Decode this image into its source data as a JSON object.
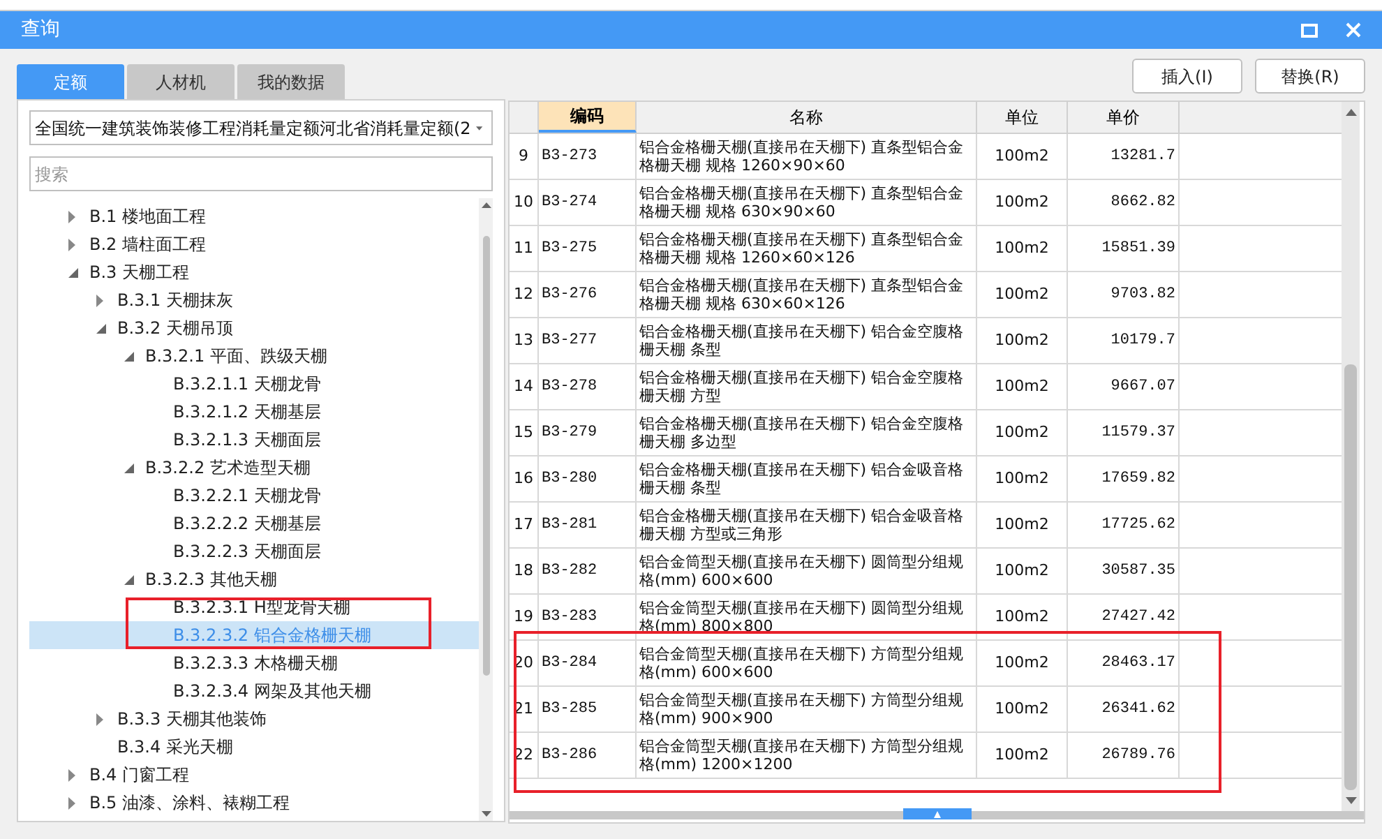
{
  "window": {
    "title": "查询"
  },
  "tabs": [
    {
      "label": "定额",
      "selected": true
    },
    {
      "label": "人材机",
      "selected": false
    },
    {
      "label": "我的数据",
      "selected": false
    }
  ],
  "buttons": [
    "插入(I)",
    "替换(R)"
  ],
  "library_select": {
    "value": "全国统一建筑装饰装修工程消耗量定额河北省消耗量定额(2"
  },
  "search": {
    "placeholder": "搜索"
  },
  "tree": [
    {
      "label": "B.1 楼地面工程",
      "kind": "group",
      "expanded": false,
      "selected": false
    },
    {
      "label": "B.2 墙柱面工程",
      "kind": "group",
      "expanded": false,
      "selected": false
    },
    {
      "label": "B.3 天棚工程",
      "kind": "group",
      "expanded": true,
      "selected": false,
      "children": [
        {
          "label": "B.3.1 天棚抹灰",
          "kind": "group",
          "expanded": false,
          "selected": false
        },
        {
          "label": "B.3.2 天棚吊顶",
          "kind": "group",
          "expanded": true,
          "selected": false,
          "children": [
            {
              "label": "B.3.2.1 平面、跌级天棚",
              "kind": "group",
              "expanded": true,
              "selected": false,
              "children": [
                {
                  "label": "B.3.2.1.1 天棚龙骨",
                  "kind": "leaf",
                  "selected": false
                },
                {
                  "label": "B.3.2.1.2 天棚基层",
                  "kind": "leaf",
                  "selected": false
                },
                {
                  "label": "B.3.2.1.3 天棚面层",
                  "kind": "leaf",
                  "selected": false
                }
              ]
            },
            {
              "label": "B.3.2.2 艺术造型天棚",
              "kind": "group",
              "expanded": true,
              "selected": false,
              "children": [
                {
                  "label": "B.3.2.2.1 天棚龙骨",
                  "kind": "leaf",
                  "selected": false
                },
                {
                  "label": "B.3.2.2.2 天棚基层",
                  "kind": "leaf",
                  "selected": false
                },
                {
                  "label": "B.3.2.2.3 天棚面层",
                  "kind": "leaf",
                  "selected": false
                }
              ]
            },
            {
              "label": "B.3.2.3 其他天棚",
              "kind": "group",
              "expanded": true,
              "selected": false,
              "children": [
                {
                  "label": "B.3.2.3.1 H型龙骨天棚",
                  "kind": "leaf",
                  "selected": false
                },
                {
                  "label": "B.3.2.3.2 铝合金格栅天棚",
                  "kind": "leaf",
                  "selected": true
                },
                {
                  "label": "B.3.2.3.3 木格栅天棚",
                  "kind": "leaf",
                  "selected": false
                },
                {
                  "label": "B.3.2.3.4 网架及其他天棚",
                  "kind": "leaf",
                  "selected": false
                }
              ]
            }
          ]
        },
        {
          "label": "B.3.3 天棚其他装饰",
          "kind": "group",
          "expanded": false,
          "selected": false
        },
        {
          "label": "B.3.4 采光天棚",
          "kind": "leaf",
          "selected": false
        }
      ]
    },
    {
      "label": "B.4 门窗工程",
      "kind": "group",
      "expanded": false,
      "selected": false
    },
    {
      "label": "B.5 油漆、涂料、裱糊工程",
      "kind": "group",
      "expanded": false,
      "selected": false
    }
  ],
  "table": {
    "columns": [
      {
        "label": "编码",
        "selected": true
      },
      {
        "label": "名称",
        "selected": false
      },
      {
        "label": "单位",
        "selected": false
      },
      {
        "label": "单价",
        "selected": false
      }
    ],
    "rows": [
      {
        "index": "9",
        "code": "B3-273",
        "name": "铝合金格栅天棚(直接吊在天棚下) 直条型铝合金格栅天棚 规格 1260×90×60",
        "unit": "100m2",
        "price": "13281.7"
      },
      {
        "index": "10",
        "code": "B3-274",
        "name": "铝合金格栅天棚(直接吊在天棚下) 直条型铝合金格栅天棚 规格 630×90×60",
        "unit": "100m2",
        "price": "8662.82"
      },
      {
        "index": "11",
        "code": "B3-275",
        "name": "铝合金格栅天棚(直接吊在天棚下) 直条型铝合金格栅天棚 规格 1260×60×126",
        "unit": "100m2",
        "price": "15851.39"
      },
      {
        "index": "12",
        "code": "B3-276",
        "name": "铝合金格栅天棚(直接吊在天棚下) 直条型铝合金格栅天棚 规格 630×60×126",
        "unit": "100m2",
        "price": "9703.82"
      },
      {
        "index": "13",
        "code": "B3-277",
        "name": "铝合金格栅天棚(直接吊在天棚下) 铝合金空腹格栅天棚 条型",
        "unit": "100m2",
        "price": "10179.7"
      },
      {
        "index": "14",
        "code": "B3-278",
        "name": "铝合金格栅天棚(直接吊在天棚下) 铝合金空腹格栅天棚 方型",
        "unit": "100m2",
        "price": "9667.07"
      },
      {
        "index": "15",
        "code": "B3-279",
        "name": "铝合金格栅天棚(直接吊在天棚下) 铝合金空腹格栅天棚 多边型",
        "unit": "100m2",
        "price": "11579.37"
      },
      {
        "index": "16",
        "code": "B3-280",
        "name": "铝合金格栅天棚(直接吊在天棚下) 铝合金吸音格栅天棚 条型",
        "unit": "100m2",
        "price": "17659.82"
      },
      {
        "index": "17",
        "code": "B3-281",
        "name": "铝合金格栅天棚(直接吊在天棚下) 铝合金吸音格栅天棚 方型或三角形",
        "unit": "100m2",
        "price": "17725.62"
      },
      {
        "index": "18",
        "code": "B3-282",
        "name": "铝合金筒型天棚(直接吊在天棚下) 圆筒型分组规格(mm) 600×600",
        "unit": "100m2",
        "price": "30587.35"
      },
      {
        "index": "19",
        "code": "B3-283",
        "name": "铝合金筒型天棚(直接吊在天棚下) 圆筒型分组规格(mm) 800×800",
        "unit": "100m2",
        "price": "27427.42"
      },
      {
        "index": "20",
        "code": "B3-284",
        "name": "铝合金筒型天棚(直接吊在天棚下) 方筒型分组规格(mm) 600×600",
        "unit": "100m2",
        "price": "28463.17"
      },
      {
        "index": "21",
        "code": "B3-285",
        "name": "铝合金筒型天棚(直接吊在天棚下) 方筒型分组规格(mm) 900×900",
        "unit": "100m2",
        "price": "26341.62"
      },
      {
        "index": "22",
        "code": "B3-286",
        "name": "铝合金筒型天棚(直接吊在天棚下) 方筒型分组规格(mm) 1200×1200",
        "unit": "100m2",
        "price": "26789.76"
      }
    ]
  }
}
